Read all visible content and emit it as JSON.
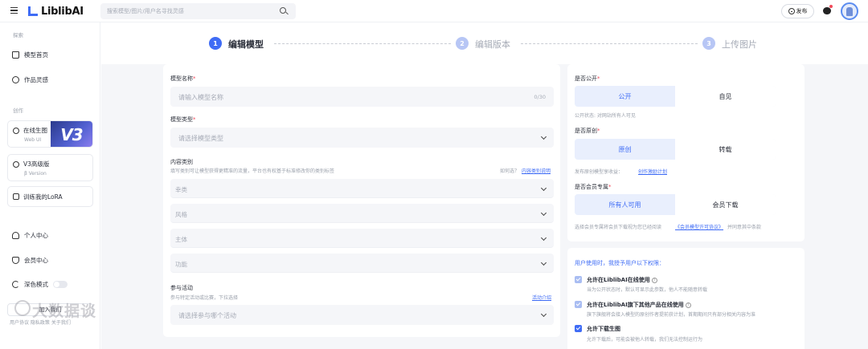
{
  "header": {
    "logo_text": "LiblibAI",
    "search_placeholder": "搜索模型/图片/用户名寻找灵感",
    "publish_label": "发布"
  },
  "sidebar": {
    "section_explore": "探索",
    "items_explore": [
      {
        "label": "模型首页",
        "icon": "home-icon"
      },
      {
        "label": "作品灵感",
        "icon": "bulb-icon"
      }
    ],
    "section_create": "创作",
    "card_online": {
      "title": "在线生图",
      "subtitle": "Web UI",
      "badge": "V3"
    },
    "card_v3": {
      "title": "V3高级版",
      "subtitle": "β Version"
    },
    "lora_label": "训练我的LoRA",
    "items_account": [
      {
        "label": "个人中心",
        "icon": "user-icon"
      },
      {
        "label": "会员中心",
        "icon": "vip-icon"
      }
    ],
    "dark_mode_label": "深色模式",
    "join_label": "加入我们",
    "footer_links": "用户协议   隐私政策   关于我们",
    "watermark": "大数据谈"
  },
  "steps": [
    {
      "num": "1",
      "label": "编辑模型",
      "active": true
    },
    {
      "num": "2",
      "label": "编辑版本",
      "active": false
    },
    {
      "num": "3",
      "label": "上传图片",
      "active": false
    }
  ],
  "form": {
    "model_name_label": "模型名称",
    "model_name_placeholder": "请输入模型名称",
    "model_name_count": "0/30",
    "model_type_label": "模型类型",
    "model_type_placeholder": "请选择模型类型",
    "content_label": "内容类别",
    "content_note": "填写类别可让模型获得更精准的流量，平台也有权基于标准修改你的类别标签",
    "content_help_prefix": "如何选？",
    "content_help_link": "内容类别说明",
    "categories": [
      "幸类",
      "风格",
      "主体",
      "功能"
    ],
    "activity_label": "参与活动",
    "activity_note": "参与特定活动或比赛，下拉选择",
    "activity_link": "活动介绍",
    "activity_placeholder": "请选择参与哪个活动"
  },
  "settings": {
    "public_label": "是否公开",
    "public_options": [
      "公开",
      "自见"
    ],
    "public_note": "公开状态: 对网站所有人可见",
    "original_label": "是否原创",
    "original_options": [
      "原创",
      "转载"
    ],
    "original_note_prefix": "发布原创模型享收益：",
    "original_link": "创作激励计划",
    "member_label": "是否会员专属",
    "member_options": [
      "所有人可用",
      "会员下载"
    ],
    "member_note_prefix": "选择会员专属将会员下载视为您已经阅读",
    "member_link": "《会员模型许可协议》",
    "member_note_suffix": "并同意其中条款"
  },
  "permissions": {
    "title": "用户使用时，我授予用户以下权限：",
    "items": [
      {
        "label": "允许在LiblibAI在线使用",
        "note": "当为公开状态时，默认可显示此参数，他人不能随意转载",
        "check": "light",
        "help": true
      },
      {
        "label": "允许在LiblibAI旗下其他产品在线使用",
        "note": "旗下旗舰将会接入模型的原创作者提前获计划，首期期间只有部分相关内容为准",
        "check": "light",
        "help": true
      },
      {
        "label": "允许下载生图",
        "note": "允许下载后，可能会被他人转载，我们无法控制运行为",
        "check": "dark",
        "help": false
      }
    ]
  },
  "colors": {
    "accent": "#3f6cf5",
    "accent_light": "#a9bdf2",
    "required": "#f04a5a",
    "page_bg": "#f5f6f9"
  }
}
